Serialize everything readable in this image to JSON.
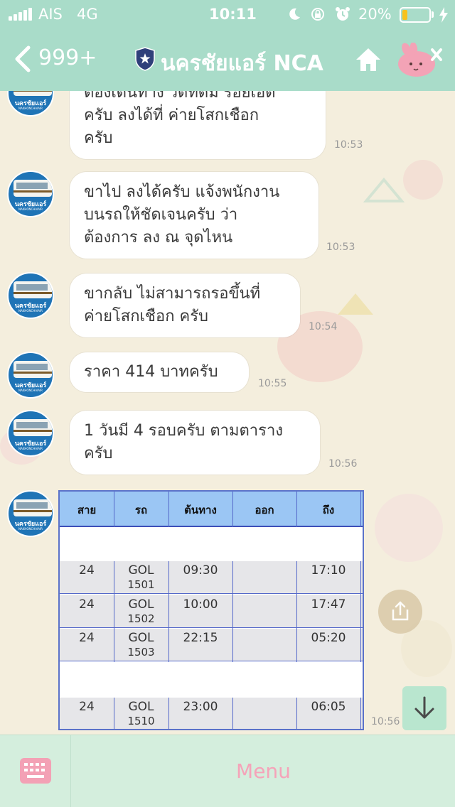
{
  "status_bar": {
    "carrier": "AIS",
    "network": "4G",
    "time": "10:11",
    "battery": "20%",
    "battery_level": 0.2
  },
  "nav": {
    "back_count": "999+",
    "title": "นครชัยแอร์ NCA"
  },
  "avatar": {
    "logo_text": "นครชัยแอร์",
    "logo_sub": "NAKHONCHAIAIR"
  },
  "messages": [
    {
      "lines": [
        "ต้องเดินทาง วัดทัดม้ ร้อยเอ็ด",
        "ครับ ลงได้ที่ ค่ายโสกเชือก",
        "ครับ"
      ],
      "time": "10:53"
    },
    {
      "lines": [
        "ขาไป ลงได้ครับ แจ้งพนักงาน",
        "บนรถให้ชัดเจนครับ ว่า",
        "ต้องการ ลง ณ จุดไหน"
      ],
      "time": "10:53"
    },
    {
      "lines": [
        "ขากลับ ไม่สามารถรอขึ้นที่",
        "ค่ายโสกเชือก ครับ"
      ],
      "time": "10:54"
    },
    {
      "lines": [
        "ราคา 414 บาทครับ"
      ],
      "time": "10:55"
    },
    {
      "lines": [
        "1 วันมี 4 รอบครับ ตามตาราง",
        "ครับ"
      ],
      "time": "10:56"
    }
  ],
  "timetable": {
    "headers": [
      "สาย",
      "รถ",
      "ต้นทาง",
      "ออก",
      "ถึง"
    ],
    "rows": [
      {
        "route": "24",
        "bus": "GOL",
        "bus_no": "1501",
        "depart": "09:30",
        "out": "",
        "arrive": "17:10"
      },
      {
        "route": "24",
        "bus": "GOL",
        "bus_no": "1502",
        "depart": "10:00",
        "out": "",
        "arrive": "17:47"
      },
      {
        "route": "24",
        "bus": "GOL",
        "bus_no": "1503",
        "depart": "22:15",
        "out": "",
        "arrive": "05:20"
      },
      {
        "route": "24",
        "bus": "GOL",
        "bus_no": "1510",
        "depart": "23:00",
        "out": "",
        "arrive": "06:05"
      }
    ],
    "time": "10:56"
  },
  "bottom": {
    "menu_label": "Menu"
  },
  "colors": {
    "header": "#a9dcc9",
    "chat_bg": "#f4eedd",
    "bottom_bar": "#d4eedd",
    "menu_text": "#f5a3b9",
    "table_header": "#9bc6f4"
  }
}
